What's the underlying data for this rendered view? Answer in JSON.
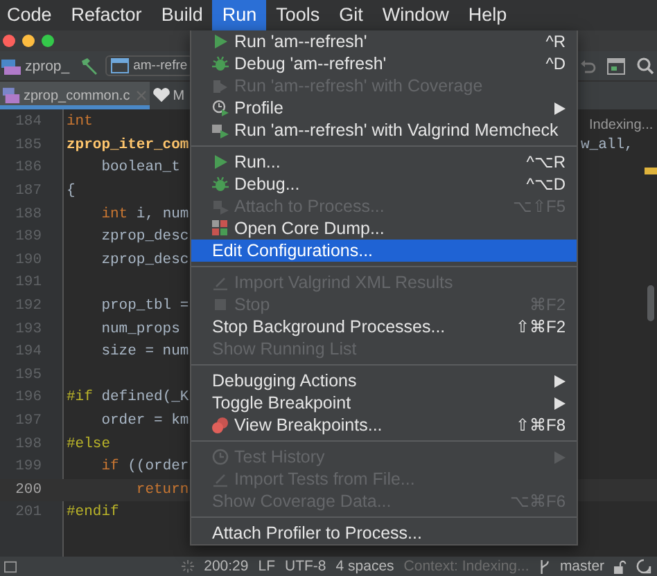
{
  "menu_bar": [
    {
      "label": "Code",
      "selected": false
    },
    {
      "label": "Refactor",
      "selected": false
    },
    {
      "label": "Build",
      "selected": false
    },
    {
      "label": "Run",
      "selected": true
    },
    {
      "label": "Tools",
      "selected": false
    },
    {
      "label": "Git",
      "selected": false
    },
    {
      "label": "Window",
      "selected": false
    },
    {
      "label": "Help",
      "selected": false
    }
  ],
  "toolbar": {
    "project": "zprop_",
    "run_config": "am--refre"
  },
  "tabs": [
    {
      "label": "zprop_common.c",
      "selected": true,
      "closable": true
    },
    {
      "label": "M",
      "selected": false,
      "closable": false
    }
  ],
  "editor": {
    "indexing": "Indexing...",
    "lines": [
      {
        "number": "184",
        "current": false,
        "code": [
          {
            "kind": "kw",
            "text": "int"
          }
        ]
      },
      {
        "number": "185",
        "current": false,
        "code": [
          {
            "kind": "fn",
            "text": "zprop_iter_com"
          }
        ],
        "tail": "w_all,"
      },
      {
        "number": "186",
        "current": false,
        "code": [
          {
            "kind": "plain",
            "text": "    boolean_t "
          }
        ]
      },
      {
        "number": "187",
        "current": false,
        "code": [
          {
            "kind": "plain",
            "text": "{"
          }
        ]
      },
      {
        "number": "188",
        "current": false,
        "code": [
          {
            "kind": "kw",
            "text": "    int"
          },
          {
            "kind": "plain",
            "text": " i, num"
          }
        ]
      },
      {
        "number": "189",
        "current": false,
        "code": [
          {
            "kind": "plain",
            "text": "    zprop_desc"
          }
        ]
      },
      {
        "number": "190",
        "current": false,
        "code": [
          {
            "kind": "plain",
            "text": "    zprop_desc"
          }
        ]
      },
      {
        "number": "191",
        "current": false
      },
      {
        "number": "192",
        "current": false,
        "code": [
          {
            "kind": "plain",
            "text": "    prop_tbl ="
          }
        ]
      },
      {
        "number": "193",
        "current": false,
        "code": [
          {
            "kind": "plain",
            "text": "    num_props "
          }
        ]
      },
      {
        "number": "194",
        "current": false,
        "code": [
          {
            "kind": "plain",
            "text": "    size = num"
          }
        ]
      },
      {
        "number": "195",
        "current": false
      },
      {
        "number": "196",
        "current": false,
        "code": [
          {
            "kind": "macro",
            "text": "#if"
          },
          {
            "kind": "plain",
            "text": " defined(_K"
          }
        ]
      },
      {
        "number": "197",
        "current": false,
        "code": [
          {
            "kind": "plain",
            "text": "    order = km"
          }
        ]
      },
      {
        "number": "198",
        "current": false,
        "code": [
          {
            "kind": "macro",
            "text": "#else"
          }
        ]
      },
      {
        "number": "199",
        "current": false,
        "code": [
          {
            "kind": "kw",
            "text": "    if"
          },
          {
            "kind": "plain",
            "text": " ((order"
          }
        ]
      },
      {
        "number": "200",
        "current": true,
        "code": [
          {
            "kind": "kw",
            "text": "        return"
          }
        ]
      },
      {
        "number": "201",
        "current": false,
        "code": [
          {
            "kind": "macro",
            "text": "#endif"
          }
        ]
      }
    ]
  },
  "run_menu": {
    "groups": [
      [
        {
          "label": "Run 'am--refresh'",
          "shortcut": "^R",
          "disabled": false,
          "selected": false,
          "submenu": false
        },
        {
          "label": "Debug 'am--refresh'",
          "shortcut": "^D",
          "disabled": false,
          "selected": false,
          "submenu": false
        },
        {
          "label": "Run 'am--refresh' with Coverage",
          "disabled": true,
          "selected": false,
          "submenu": false
        },
        {
          "label": "Profile",
          "disabled": false,
          "selected": false,
          "submenu": true
        },
        {
          "label": "Run 'am--refresh' with Valgrind Memcheck",
          "disabled": false,
          "selected": false,
          "submenu": false
        }
      ],
      [
        {
          "label": "Run...",
          "shortcut": "^⌥R",
          "disabled": false,
          "selected": false,
          "submenu": false
        },
        {
          "label": "Debug...",
          "shortcut": "^⌥D",
          "disabled": false,
          "selected": false,
          "submenu": false
        },
        {
          "label": "Attach to Process...",
          "shortcut": "⌥⇧F5",
          "disabled": true,
          "selected": false,
          "submenu": false
        },
        {
          "label": "Open Core Dump...",
          "disabled": false,
          "selected": false,
          "submenu": false
        },
        {
          "label": "Edit Configurations...",
          "disabled": false,
          "selected": true,
          "submenu": false
        }
      ],
      [
        {
          "label": "Import Valgrind XML Results",
          "disabled": true,
          "selected": false,
          "submenu": false
        },
        {
          "label": "Stop",
          "shortcut": "⌘F2",
          "disabled": true,
          "selected": false,
          "submenu": false
        },
        {
          "label": "Stop Background Processes...",
          "shortcut": "⇧⌘F2",
          "disabled": false,
          "selected": false,
          "submenu": false
        },
        {
          "label": "Show Running List",
          "disabled": true,
          "selected": false,
          "submenu": false
        }
      ],
      [
        {
          "label": "Debugging Actions",
          "disabled": false,
          "selected": false,
          "submenu": true
        },
        {
          "label": "Toggle Breakpoint",
          "disabled": false,
          "selected": false,
          "submenu": true
        },
        {
          "label": "View Breakpoints...",
          "shortcut": "⇧⌘F8",
          "disabled": false,
          "selected": false,
          "submenu": false
        }
      ],
      [
        {
          "label": "Test History",
          "disabled": true,
          "selected": false,
          "submenu": true
        },
        {
          "label": "Import Tests from File...",
          "disabled": true,
          "selected": false,
          "submenu": false
        },
        {
          "label": "Show Coverage Data...",
          "shortcut": "⌥⌘F6",
          "disabled": true,
          "selected": false,
          "submenu": false
        }
      ],
      [
        {
          "label": "Attach Profiler to Process...",
          "disabled": false,
          "selected": false,
          "submenu": false
        }
      ]
    ]
  },
  "status_bar": {
    "position": "200:29",
    "line_separator": "LF",
    "encoding": "UTF-8",
    "indent": "4 spaces",
    "context": "Context: Indexing...",
    "branch": "master"
  }
}
